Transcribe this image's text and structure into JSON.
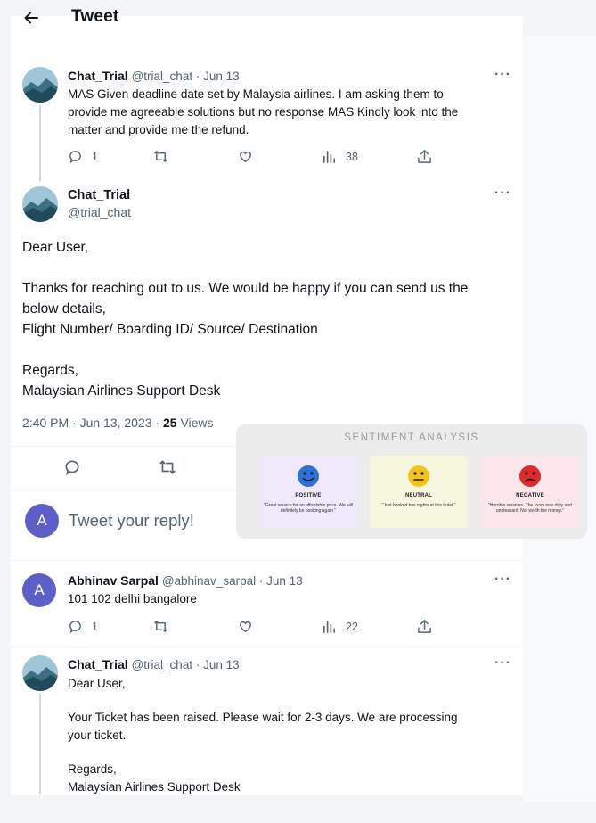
{
  "header": {
    "title": "Tweet"
  },
  "tweet_top": {
    "name": "Chat_Trial",
    "handle": "@trial_chat",
    "date": "Jun 13",
    "text_lines": [
      "MAS Given deadline date set by Malaysia airlines. I am asking them to",
      "provide me  agreeable solutions but no response MAS Kindly look into the",
      "matter and provide me the refund."
    ],
    "replies": "1",
    "views": "38"
  },
  "main_tweet": {
    "name": "Chat_Trial",
    "handle": "@trial_chat",
    "lines": [
      "Dear User,",
      "Thanks for reaching out to us. We would be happy if you can send us the",
      "below details,",
      "Flight Number/ Boarding ID/ Source/ Destination",
      "Regards,",
      "Malaysian Airlines Support Desk"
    ],
    "time": "2:40 PM · Jun 13, 2023 · ",
    "views_count": "25",
    "views_label": " Views"
  },
  "reply_box": {
    "avatar_letter": "A",
    "placeholder": "Tweet your reply!"
  },
  "reply1": {
    "avatar_letter": "A",
    "name": "Abhinav Sarpal",
    "handle": "@abhinav_sarpal",
    "date": "Jun 13",
    "text": "101 102 delhi bangalore",
    "replies": "1",
    "views": "22"
  },
  "reply2": {
    "name": "Chat_Trial",
    "handle": "@trial_chat",
    "date": "Jun 13",
    "lines": [
      "Dear User,",
      "Your Ticket has been raised. Please wait for 2-3 days. We are processing",
      "your ticket.",
      "Regards,",
      "Malaysian Airlines Support Desk"
    ]
  },
  "sentiment": {
    "title": "SENTIMENT ANALYSIS",
    "cards": [
      {
        "label": "POSITIVE",
        "quote": "\"Great service for an affordable price. We will definitely be booking again.\"",
        "bg": "#efe9fb",
        "face": "#2f6fd8"
      },
      {
        "label": "NEUTRAL",
        "quote": "\"Just booked two nights at this hotel.\"",
        "bg": "#f5f6db",
        "face": "#f2c31b"
      },
      {
        "label": "NEGATIVE",
        "quote": "\"Horrible services. The room was dirty and unpleasant. Not worth the money.\"",
        "bg": "#fbe6ec",
        "face": "#e02a2a"
      }
    ]
  },
  "sep": " · "
}
